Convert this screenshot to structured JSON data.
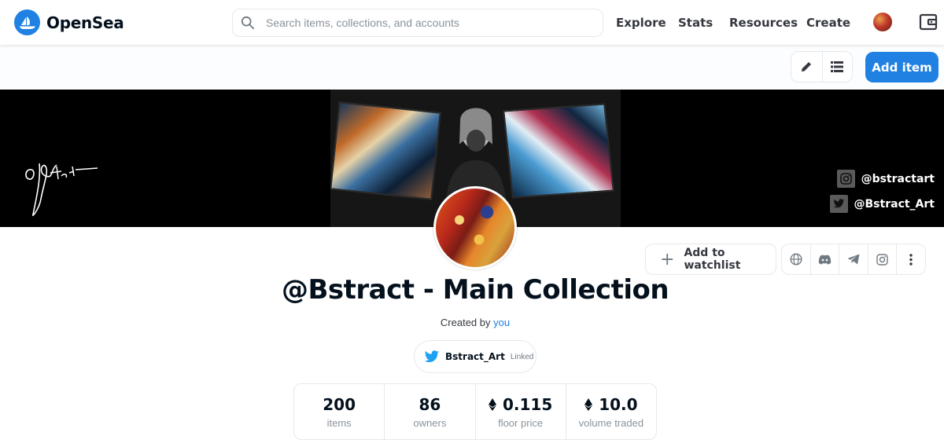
{
  "nav": {
    "brand": "OpenSea",
    "search_placeholder": "Search items, collections, and accounts",
    "links": [
      "Explore",
      "Stats",
      "Resources",
      "Create"
    ]
  },
  "toolbar": {
    "add_item_label": "Add item"
  },
  "banner": {
    "instagram_handle": "@bstractart",
    "twitter_handle": "@Bstract_Art"
  },
  "actions": {
    "watchlist_label": "Add to watchlist",
    "icons": [
      "globe-icon",
      "discord-icon",
      "telegram-icon",
      "instagram-icon",
      "more-icon"
    ]
  },
  "collection": {
    "title": "@Bstract - Main Collection",
    "created_by_prefix": "Created by",
    "creator": "you",
    "twitter_handle": "Bstract_Art",
    "twitter_status": "Linked"
  },
  "stats": [
    {
      "value": "200",
      "label": "items",
      "eth": false
    },
    {
      "value": "86",
      "label": "owners",
      "eth": false
    },
    {
      "value": "0.115",
      "label": "floor price",
      "eth": true
    },
    {
      "value": "10.0",
      "label": "volume traded",
      "eth": true
    }
  ],
  "colors": {
    "accent": "#2081e2",
    "text": "#04111d",
    "muted": "#8a939b",
    "border": "#e5e8eb"
  }
}
